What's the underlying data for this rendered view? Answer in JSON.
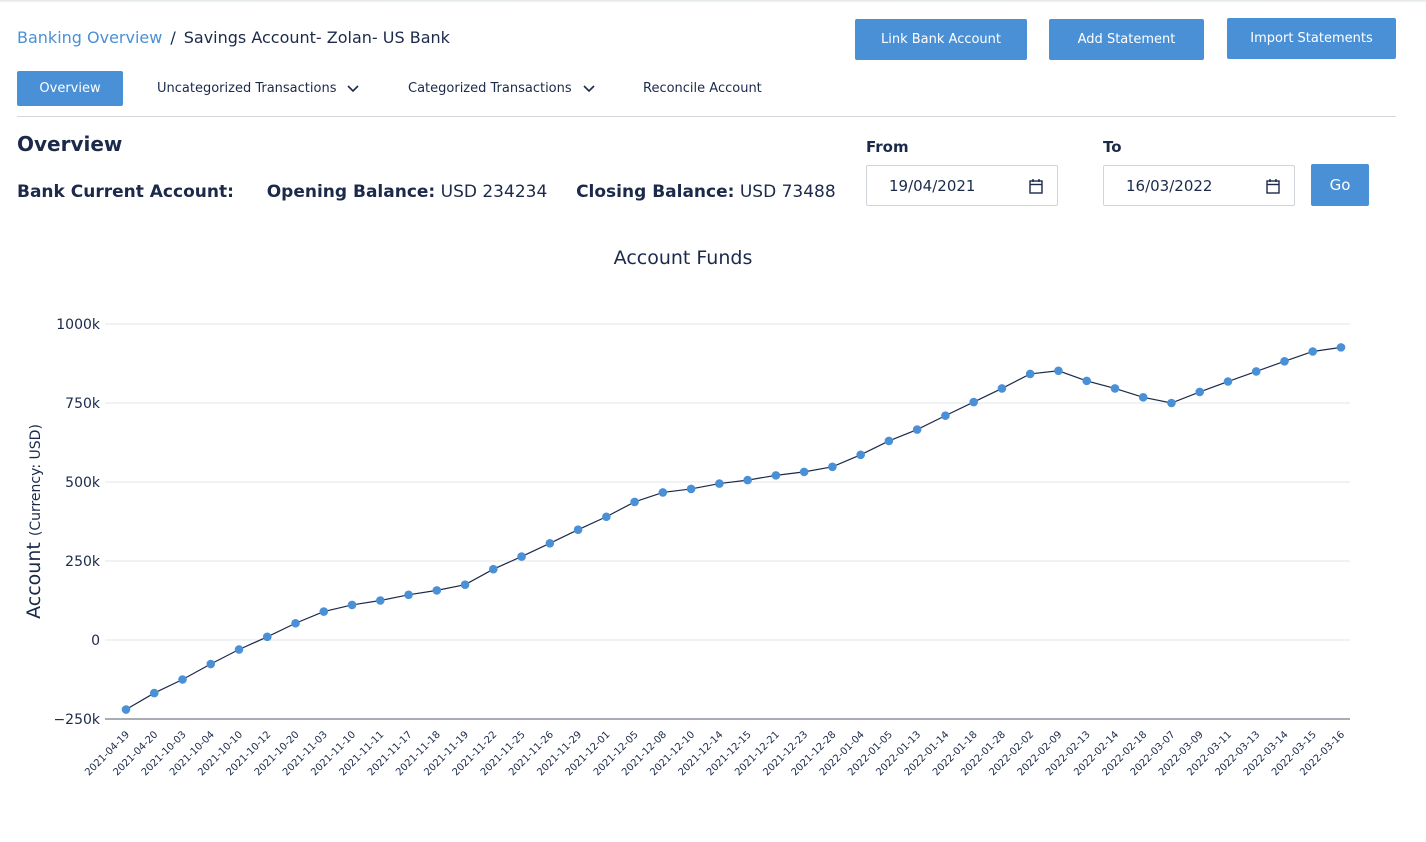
{
  "breadcrumb": {
    "link": "Banking Overview",
    "separator": "/",
    "current": "Savings Account- Zolan- US Bank"
  },
  "actions": {
    "link_bank": "Link Bank Account",
    "add_statement": "Add Statement",
    "import_statements": "Import Statements"
  },
  "tabs": [
    {
      "label": "Overview",
      "active": true
    },
    {
      "label": "Uncategorized Transactions",
      "dropdown": true
    },
    {
      "label": "Categorized Transactions",
      "dropdown": true
    },
    {
      "label": "Reconcile Account"
    }
  ],
  "overview": {
    "title": "Overview",
    "account_label": "Bank Current Account:",
    "opening_label": "Opening Balance:",
    "opening_value": "USD 234234",
    "closing_label": "Closing Balance:",
    "closing_value": "USD 73488"
  },
  "filter": {
    "from_label": "From",
    "from_value": "19/04/2021",
    "to_label": "To",
    "to_value": "16/03/2022",
    "go_label": "Go"
  },
  "colors": {
    "accent": "#4a90d6",
    "text": "#1b2a4a",
    "line": "#1b2a4a",
    "marker": "#4a90d6",
    "grid": "#e3e6ea"
  },
  "icons": {
    "calendar": "calendar-icon",
    "dropdown": "chevron-down-icon"
  },
  "chart_data": {
    "type": "line",
    "title": "Account Funds",
    "ylabel": "Account",
    "ylabel_unit": "(Currency: USD)",
    "xlabel": "",
    "ylim": [
      -250000,
      1000000
    ],
    "yticks": [
      -250000,
      0,
      250000,
      500000,
      750000,
      1000000
    ],
    "ytick_labels": [
      "−250k",
      "0",
      "250k",
      "500k",
      "750k",
      "1000k"
    ],
    "grid": true,
    "legend": "none",
    "categories": [
      "2021-04-19",
      "2021-04-20",
      "2021-10-03",
      "2021-10-04",
      "2021-10-10",
      "2021-10-12",
      "2021-10-20",
      "2021-11-03",
      "2021-11-10",
      "2021-11-11",
      "2021-11-17",
      "2021-11-18",
      "2021-11-19",
      "2021-11-22",
      "2021-11-25",
      "2021-11-26",
      "2021-11-29",
      "2021-12-01",
      "2021-12-05",
      "2021-12-08",
      "2021-12-10",
      "2021-12-14",
      "2021-12-15",
      "2021-12-21",
      "2021-12-23",
      "2021-12-28",
      "2022-01-04",
      "2022-01-05",
      "2022-01-13",
      "2022-01-14",
      "2022-01-18",
      "2022-01-28",
      "2022-02-02",
      "2022-02-09",
      "2022-02-13",
      "2022-02-14",
      "2022-02-18",
      "2022-03-07",
      "2022-03-09",
      "2022-03-11",
      "2022-03-13",
      "2022-03-14",
      "2022-03-15",
      "2022-03-16"
    ],
    "series": [
      {
        "values": [
          -220000,
          -168000,
          -125000,
          -76000,
          -30000,
          10000,
          53000,
          90000,
          111000,
          125000,
          143000,
          157000,
          175000,
          224000,
          264000,
          306000,
          349000,
          390000,
          437000,
          467000,
          478000,
          495000,
          506000,
          521000,
          532000,
          548000,
          586000,
          630000,
          666000,
          710000,
          753000,
          796000,
          842000,
          852000,
          820000,
          796000,
          768000,
          750000,
          785000,
          818000,
          850000,
          882000,
          913000,
          926000
        ]
      }
    ]
  }
}
